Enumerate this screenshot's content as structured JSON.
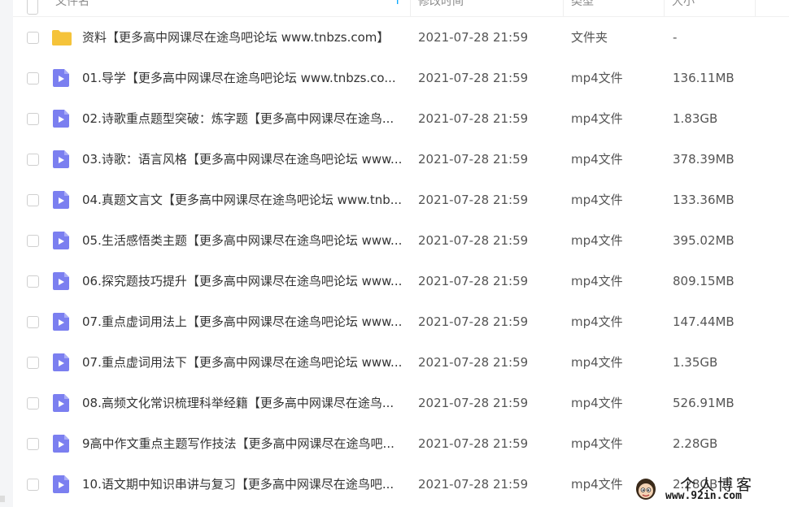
{
  "header": {
    "name": "文件名",
    "sort_icon": "↑",
    "time": "修改时间",
    "type": "类型",
    "size": "大小"
  },
  "icons": {
    "folder_color": "#f5c33b",
    "video_color": "#7b7ff0"
  },
  "files": [
    {
      "icon": "folder-icon",
      "name": "资料【更多高中网课尽在途鸟吧论坛 www.tnbzs.com】",
      "time": "2021-07-28 21:59",
      "type": "文件夹",
      "size": "-"
    },
    {
      "icon": "video-file-icon",
      "name": "01.导学【更多高中网课尽在途鸟吧论坛 www.tnbzs.co...",
      "time": "2021-07-28 21:59",
      "type": "mp4文件",
      "size": "136.11MB"
    },
    {
      "icon": "video-file-icon",
      "name": "02.诗歌重点题型突破：炼字题【更多高中网课尽在途鸟...",
      "time": "2021-07-28 21:59",
      "type": "mp4文件",
      "size": "1.83GB"
    },
    {
      "icon": "video-file-icon",
      "name": "03.诗歌：语言风格【更多高中网课尽在途鸟吧论坛 www...",
      "time": "2021-07-28 21:59",
      "type": "mp4文件",
      "size": "378.39MB"
    },
    {
      "icon": "video-file-icon",
      "name": "04.真题文言文【更多高中网课尽在途鸟吧论坛 www.tnb...",
      "time": "2021-07-28 21:59",
      "type": "mp4文件",
      "size": "133.36MB"
    },
    {
      "icon": "video-file-icon",
      "name": "05.生活感悟类主题【更多高中网课尽在途鸟吧论坛 www...",
      "time": "2021-07-28 21:59",
      "type": "mp4文件",
      "size": "395.02MB"
    },
    {
      "icon": "video-file-icon",
      "name": "06.探究题技巧提升【更多高中网课尽在途鸟吧论坛 www...",
      "time": "2021-07-28 21:59",
      "type": "mp4文件",
      "size": "809.15MB"
    },
    {
      "icon": "video-file-icon",
      "name": "07.重点虚词用法上【更多高中网课尽在途鸟吧论坛 www...",
      "time": "2021-07-28 21:59",
      "type": "mp4文件",
      "size": "147.44MB"
    },
    {
      "icon": "video-file-icon",
      "name": "07.重点虚词用法下【更多高中网课尽在途鸟吧论坛 www...",
      "time": "2021-07-28 21:59",
      "type": "mp4文件",
      "size": "1.35GB"
    },
    {
      "icon": "video-file-icon",
      "name": "08.高频文化常识梳理科举经籍【更多高中网课尽在途鸟...",
      "time": "2021-07-28 21:59",
      "type": "mp4文件",
      "size": "526.91MB"
    },
    {
      "icon": "video-file-icon",
      "name": "9高中作文重点主题写作技法【更多高中网课尽在途鸟吧...",
      "time": "2021-07-28 21:59",
      "type": "mp4文件",
      "size": "2.28GB"
    },
    {
      "icon": "video-file-icon",
      "name": "10.语文期中知识串讲与复习【更多高中网课尽在途鸟吧...",
      "time": "2021-07-28 21:59",
      "type": "mp4文件",
      "size": "2.28GB"
    }
  ],
  "watermark": {
    "title": "个人博客",
    "url": "www.92in.com"
  }
}
